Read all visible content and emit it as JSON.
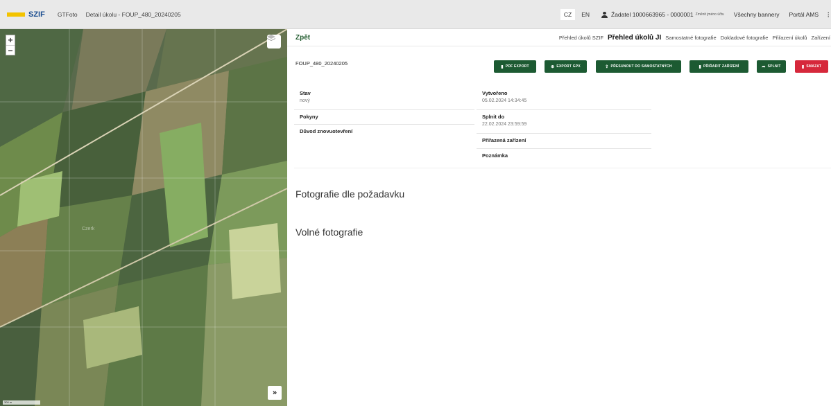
{
  "header": {
    "logo": "SZIF",
    "app_name": "GTFoto",
    "breadcrumb": "Detail úkolu - FOUP_480_20240205",
    "lang_cz": "CZ",
    "lang_en": "EN",
    "user": "Žadatel 1000663965 - 0000001",
    "change_name": "Změnit jméno účtu",
    "banners": "Všechny bannery",
    "portal": "Portál AMS"
  },
  "map": {
    "zoom_in": "+",
    "zoom_out": "−",
    "expand": "»",
    "scale": "300 m",
    "place_label": "Czerk"
  },
  "nav": {
    "back": "Zpět",
    "tabs": [
      "Přehled úkolů SZIF",
      "Přehled úkolů JI",
      "Samostatné fotografie",
      "Dokladové fotografie",
      "Přiřazení úkolů",
      "Zařízení"
    ],
    "active_tab": 1
  },
  "task": {
    "id": "FOUP_480_20240205",
    "buttons": {
      "pdf": "PDF EXPORT",
      "gpx": "EXPORT GPX",
      "move": "PŘESUNOUT DO SAMOSTATNÝCH",
      "assign": "PŘIŘADIT ZAŘÍZENÍ",
      "done": "SPLNIT",
      "delete": "SMAZAT"
    },
    "left": {
      "status_label": "Stav",
      "status_value": "nový",
      "instructions_label": "Pokyny",
      "reopen_label": "Důvod znovuotevření"
    },
    "right": {
      "created_label": "Vytvořeno",
      "created_value": "05.02.2024 14:34:45",
      "due_label": "Splnit do",
      "due_value": "22.02.2024 23:59:59",
      "devices_label": "Přiřazená zařízení",
      "note_label": "Poznámka"
    }
  },
  "sections": {
    "requested": "Fotografie dle požadavku",
    "free": "Volné fotografie"
  },
  "colors": {
    "primary_green": "#1c5a32",
    "danger_red": "#d6283b",
    "logo_yellow": "#f3c300"
  }
}
